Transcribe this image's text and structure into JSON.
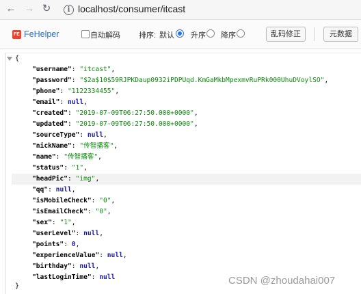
{
  "browser": {
    "url": "localhost/consumer/itcast"
  },
  "toolbar": {
    "brand": "FeHelper",
    "auto_decode_label": "自动解码",
    "sort_label": "排序:",
    "sort_options": [
      "默认",
      "升序",
      "降序"
    ],
    "sort_selected": "默认",
    "fix_button": "乱码修正",
    "raw_button": "元数据"
  },
  "json": {
    "open": "{",
    "close": "}",
    "entries": [
      {
        "key": "\"username\"",
        "value": "\"itcast\"",
        "type": "str",
        "comma": ","
      },
      {
        "key": "\"password\"",
        "value": "\"$2a$10$59RJPKDaup0932iPDPUqd.KmGaMkbMpexmvRuPRk000UhuDVoylSO\"",
        "type": "str",
        "comma": ","
      },
      {
        "key": "\"phone\"",
        "value": "\"1122334455\"",
        "type": "str",
        "comma": ","
      },
      {
        "key": "\"email\"",
        "value": "null",
        "type": "kw",
        "comma": ","
      },
      {
        "key": "\"created\"",
        "value": "\"2019-07-09T06:27:50.000+0000\"",
        "type": "str",
        "comma": ","
      },
      {
        "key": "\"updated\"",
        "value": "\"2019-07-09T06:27:50.000+0000\"",
        "type": "str",
        "comma": ","
      },
      {
        "key": "\"sourceType\"",
        "value": "null",
        "type": "kw",
        "comma": ","
      },
      {
        "key": "\"nickName\"",
        "value": "\"传智播客\"",
        "type": "str",
        "comma": ","
      },
      {
        "key": "\"name\"",
        "value": "\"传智播客\"",
        "type": "str",
        "comma": ","
      },
      {
        "key": "\"status\"",
        "value": "\"1\"",
        "type": "str",
        "comma": ","
      },
      {
        "key": "\"headPic\"",
        "value": "\"img\"",
        "type": "str",
        "comma": ","
      },
      {
        "key": "\"qq\"",
        "value": "null",
        "type": "kw",
        "comma": ","
      },
      {
        "key": "\"isMobileCheck\"",
        "value": "\"0\"",
        "type": "str",
        "comma": ","
      },
      {
        "key": "\"isEmailCheck\"",
        "value": "\"0\"",
        "type": "str",
        "comma": ","
      },
      {
        "key": "\"sex\"",
        "value": "\"1\"",
        "type": "str",
        "comma": ","
      },
      {
        "key": "\"userLevel\"",
        "value": "null",
        "type": "kw",
        "comma": ","
      },
      {
        "key": "\"points\"",
        "value": "0",
        "type": "num",
        "comma": ","
      },
      {
        "key": "\"experienceValue\"",
        "value": "null",
        "type": "kw",
        "comma": ","
      },
      {
        "key": "\"birthday\"",
        "value": "null",
        "type": "kw",
        "comma": ","
      },
      {
        "key": "\"lastLoginTime\"",
        "value": "null",
        "type": "kw",
        "comma": ""
      }
    ],
    "highlighted_key": "\"headPic\""
  },
  "watermark": "CSDN @zhoudahai007"
}
